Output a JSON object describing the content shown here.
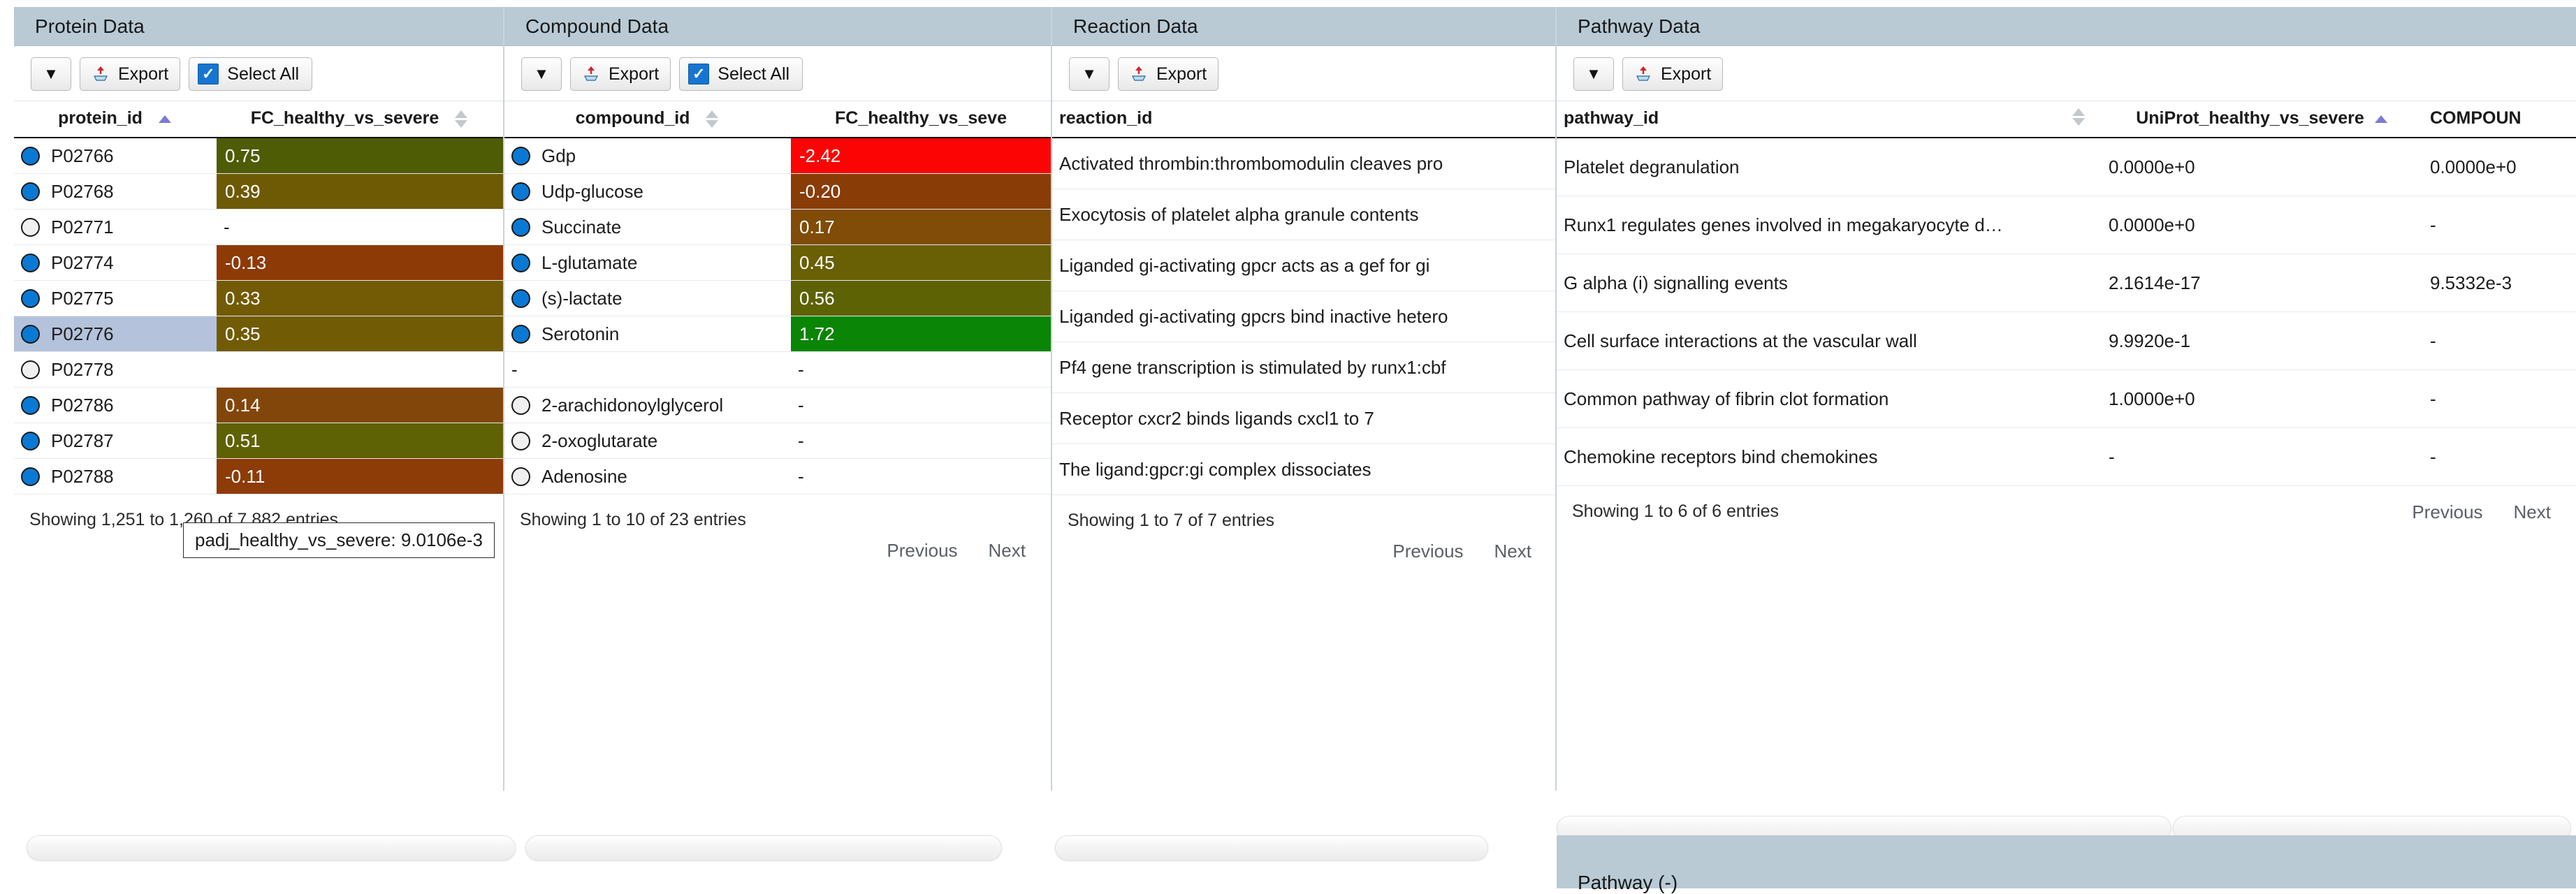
{
  "colors": {
    "panel_header_bg": "#b9cad4",
    "accent_checkbox": "#1675d1",
    "node_on": "#0a79d4",
    "node_off": "#f0f0f0",
    "selected_row": "#b4c2db",
    "sort_active": "#7b7bd4",
    "sort_inactive": "#c3c8cc"
  },
  "common": {
    "caret_label": "▼",
    "export_label": "Export",
    "select_all_label": "Select All",
    "previous_label": "Previous",
    "next_label": "Next",
    "dash": "-"
  },
  "panels": {
    "protein": {
      "title": "Protein Data",
      "columns": [
        {
          "label": "protein_id",
          "sort": "asc"
        },
        {
          "label": "FC_healthy_vs_severe",
          "sort": "none"
        }
      ],
      "rows": [
        {
          "node": "on",
          "id": "P02766",
          "value": "0.75",
          "bg": "#4e5c06",
          "selected": false
        },
        {
          "node": "on",
          "id": "P02768",
          "value": "0.39",
          "bg": "#6e5a05",
          "selected": false
        },
        {
          "node": "off",
          "id": "P02771",
          "value": "-",
          "bg": "",
          "selected": false
        },
        {
          "node": "on",
          "id": "P02774",
          "value": "-0.13",
          "bg": "#8e3a07",
          "selected": false
        },
        {
          "node": "on",
          "id": "P02775",
          "value": "0.33",
          "bg": "#735b05",
          "selected": false
        },
        {
          "node": "on",
          "id": "P02776",
          "value": "0.35",
          "bg": "#715c05",
          "selected": true
        },
        {
          "node": "off",
          "id": "P02778",
          "value": "",
          "bg": "",
          "selected": false
        },
        {
          "node": "on",
          "id": "P02786",
          "value": "0.14",
          "bg": "#83460a",
          "selected": false
        },
        {
          "node": "on",
          "id": "P02787",
          "value": "0.51",
          "bg": "#5f6105",
          "selected": false
        },
        {
          "node": "on",
          "id": "P02788",
          "value": "-0.11",
          "bg": "#8d3b07",
          "selected": false
        }
      ],
      "tooltip": "padj_healthy_vs_severe: 9.0106e-3",
      "showing": "Showing 1,251 to 1,260 of 7,882 entries",
      "has_select_all": true
    },
    "compound": {
      "title": "Compound Data",
      "columns": [
        {
          "label": "compound_id",
          "sort": "none"
        },
        {
          "label": "FC_healthy_vs_seve",
          "sort": "none"
        }
      ],
      "rows": [
        {
          "node": "on",
          "id": "Gdp",
          "value": "-2.42",
          "bg": "#fc0404"
        },
        {
          "node": "on",
          "id": "Udp-glucose",
          "value": "-0.20",
          "bg": "#8a3c07"
        },
        {
          "node": "on",
          "id": "Succinate",
          "value": "0.17",
          "bg": "#804c08"
        },
        {
          "node": "on",
          "id": "L-glutamate",
          "value": "0.45",
          "bg": "#695f05"
        },
        {
          "node": "on",
          "id": "(s)-lactate",
          "value": "0.56",
          "bg": "#5d6205"
        },
        {
          "node": "on",
          "id": "Serotonin",
          "value": "1.72",
          "bg": "#0a8506"
        },
        {
          "node": "none",
          "id": "-",
          "value": "-",
          "bg": ""
        },
        {
          "node": "off",
          "id": "2-arachidonoylglycerol",
          "value": "-",
          "bg": ""
        },
        {
          "node": "off",
          "id": "2-oxoglutarate",
          "value": "-",
          "bg": ""
        },
        {
          "node": "off",
          "id": "Adenosine",
          "value": "-",
          "bg": ""
        }
      ],
      "showing": "Showing 1 to 10 of 23 entries",
      "has_select_all": true
    },
    "reaction": {
      "title": "Reaction Data",
      "columns": [
        {
          "label": "reaction_id",
          "sort": "none"
        }
      ],
      "rows": [
        {
          "id": "Activated thrombin:thrombomodulin cleaves pro"
        },
        {
          "id": "Exocytosis of platelet alpha granule contents"
        },
        {
          "id": "Liganded gi-activating gpcr acts as a gef for gi"
        },
        {
          "id": "Liganded gi-activating gpcrs bind inactive hetero"
        },
        {
          "id": "Pf4 gene transcription is stimulated by runx1:cbf"
        },
        {
          "id": "Receptor cxcr2 binds ligands cxcl1 to 7"
        },
        {
          "id": "The ligand:gpcr:gi complex dissociates"
        }
      ],
      "showing": "Showing 1 to 7 of 7 entries",
      "has_select_all": false
    },
    "pathway": {
      "title": "Pathway Data",
      "columns": [
        {
          "label": "pathway_id",
          "sort": "none"
        },
        {
          "label": "UniProt_healthy_vs_severe",
          "sort": "asc"
        },
        {
          "label": "COMPOUN",
          "sort": "none"
        }
      ],
      "rows": [
        {
          "id": "Platelet degranulation",
          "uniprot": "0.0000e+0",
          "compound": "0.0000e+0"
        },
        {
          "id": "Runx1 regulates genes involved in megakaryocyte d…",
          "uniprot": "0.0000e+0",
          "compound": "-"
        },
        {
          "id": "G alpha (i) signalling events",
          "uniprot": "2.1614e-17",
          "compound": "9.5332e-3"
        },
        {
          "id": "Cell surface interactions at the vascular wall",
          "uniprot": "9.9920e-1",
          "compound": "-"
        },
        {
          "id": "Common pathway of fibrin clot formation",
          "uniprot": "1.0000e+0",
          "compound": "-"
        },
        {
          "id": "Chemokine receptors bind chemokines",
          "uniprot": "-",
          "compound": "-"
        }
      ],
      "showing": "Showing 1 to 6 of 6 entries",
      "has_select_all": false
    }
  },
  "bottom_strip": {
    "label": "Pathway (-)"
  }
}
